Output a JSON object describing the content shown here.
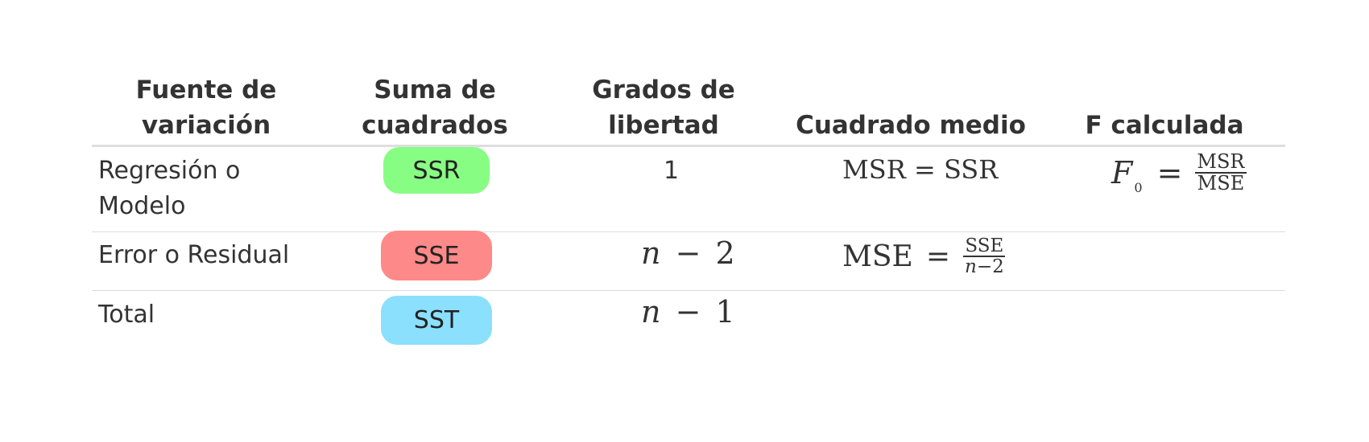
{
  "table": {
    "headers": {
      "source": [
        "Fuente de",
        "variación"
      ],
      "sum_sq": [
        "Suma de",
        "cuadrados"
      ],
      "df": [
        "Grados de",
        "libertad"
      ],
      "mean_sq": "Cuadrado medio",
      "f_calc": "F calculada"
    },
    "rows": [
      {
        "source": [
          "Regresión o",
          "Modelo"
        ],
        "sum_sq": "SSR",
        "df": "1",
        "mean_sq": {
          "lhs": "MSR",
          "eq": "=",
          "rhs": "SSR"
        },
        "f_calc": {
          "lhs": "F",
          "sub": "0",
          "eq": "=",
          "num": "MSR",
          "den": "MSE"
        }
      },
      {
        "source": "Error o Residual",
        "sum_sq": "SSE",
        "df": {
          "var": "n",
          "op": "−",
          "num": "2"
        },
        "mean_sq": {
          "lhs": "MSE",
          "eq": "=",
          "num": "SSE",
          "den_var": "n",
          "den_op": "−",
          "den_num": "2"
        }
      },
      {
        "source": "Total",
        "sum_sq": "SST",
        "df": {
          "var": "n",
          "op": "−",
          "num": "1"
        }
      }
    ]
  },
  "colors": {
    "ssr": "#88fd83",
    "sse": "#fe8989",
    "sst": "#8ae0fd",
    "text": "#333333",
    "rule": "#dddddd"
  }
}
